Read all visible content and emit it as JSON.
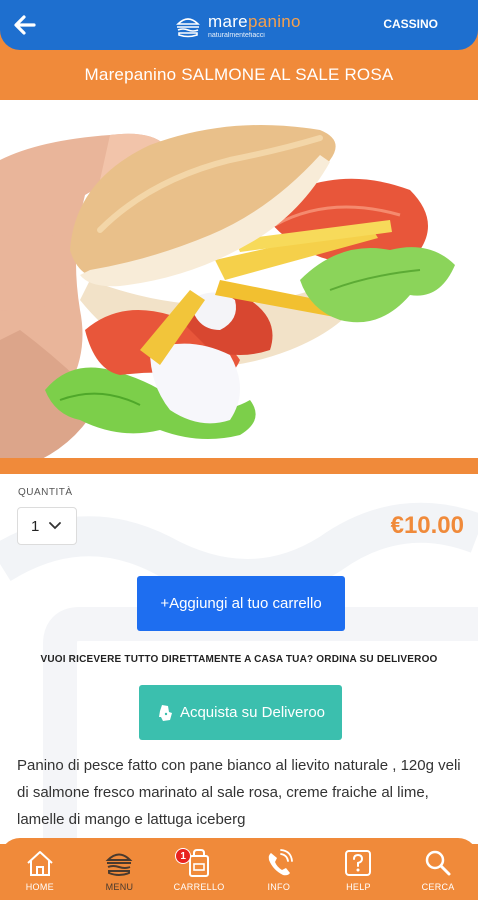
{
  "header": {
    "logo_main_a": "mare",
    "logo_main_b": "panino",
    "logo_sub": "naturalmentefiacci",
    "location": "CASSINO"
  },
  "product": {
    "title": "Marepanino SALMONE AL SALE ROSA",
    "quantity_label": "QUANTITÀ",
    "quantity_value": "1",
    "price": "€10.00",
    "description": "Panino di pesce fatto con pane bianco al lievito naturale , 120g veli di salmone fresco marinato al sale rosa, creme fraiche al lime, lamelle di mango e lattuga iceberg"
  },
  "actions": {
    "add_to_cart": "+Aggiungi al tuo carrello",
    "deliveroo_prompt": "VUOI RICEVERE TUTTO DIRETTAMENTE A CASA TUA? ORDINA SU DELIVEROO",
    "deliveroo_button": "Acquista su Deliveroo"
  },
  "bottom_nav": {
    "items": [
      {
        "label": "HOME",
        "icon": "home-icon"
      },
      {
        "label": "MENU",
        "icon": "burger-icon"
      },
      {
        "label": "CARRELLO",
        "icon": "cart-icon",
        "badge": "1"
      },
      {
        "label": "INFO",
        "icon": "phone-icon"
      },
      {
        "label": "HELP",
        "icon": "help-icon"
      },
      {
        "label": "CERCA",
        "icon": "search-icon"
      }
    ]
  },
  "colors": {
    "header_blue": "#1e6fcf",
    "accent_orange": "#f08a3a",
    "cart_button_blue": "#1e6ef0",
    "deliveroo_teal": "#3bbfae",
    "badge_red": "#e8231f"
  }
}
